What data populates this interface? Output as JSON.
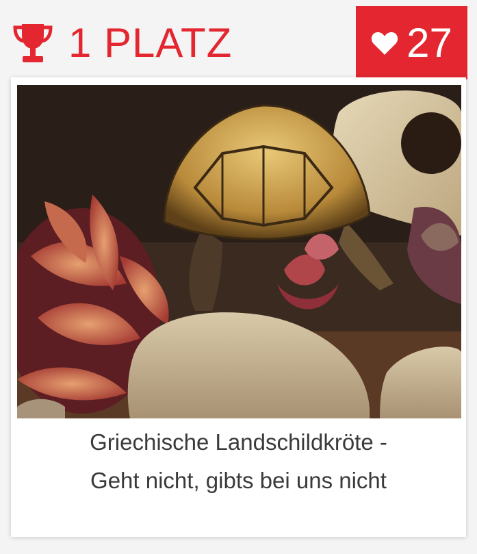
{
  "rank": {
    "label": "1 PLATZ",
    "icon": "trophy-icon",
    "color": "#e3262f"
  },
  "likes": {
    "count": "27",
    "icon": "heart-icon",
    "color": "#e3262f"
  },
  "entry": {
    "photo_subject": "tortoise-photo",
    "caption_line1": "Griechische Landschildkröte -",
    "caption_line2": "Geht nicht, gibts bei uns nicht"
  }
}
